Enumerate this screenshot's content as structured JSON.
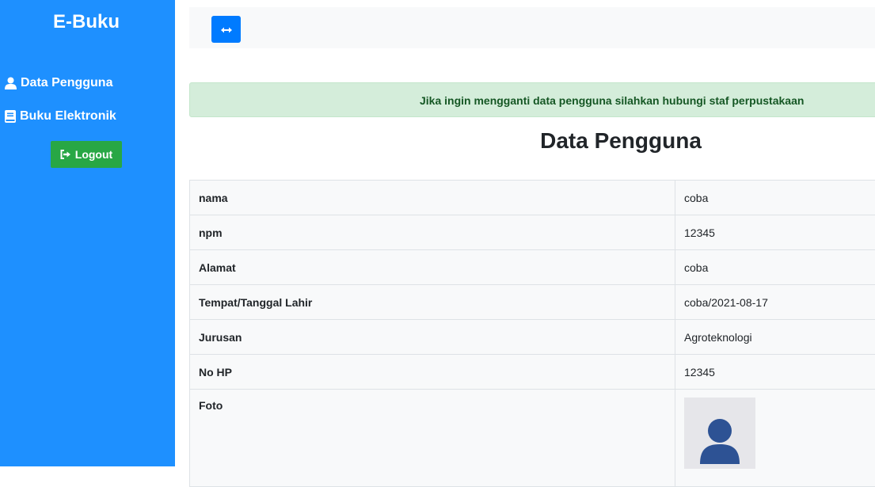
{
  "sidebar": {
    "brand": "E-Buku",
    "items": [
      {
        "label": "Data Pengguna",
        "icon": "user-icon"
      },
      {
        "label": "Buku Elektronik",
        "icon": "book-icon"
      }
    ],
    "logout_label": "Logout",
    "logout_icon": "sign-out-icon"
  },
  "header": {
    "toggle_icon": "arrows-horizontal-icon"
  },
  "alert": {
    "message": "Jika ingin mengganti data pengguna silahkan hubungi staf perpustakaan"
  },
  "main": {
    "title": "Data Pengguna",
    "rows": [
      {
        "label": "nama",
        "value": "coba"
      },
      {
        "label": "npm",
        "value": "12345"
      },
      {
        "label": "Alamat",
        "value": "coba"
      },
      {
        "label": "Tempat/Tanggal Lahir",
        "value": "coba/2021-08-17"
      },
      {
        "label": "Jurusan",
        "value": "Agroteknologi"
      },
      {
        "label": "No HP",
        "value": "12345"
      },
      {
        "label": "Foto",
        "value": ""
      }
    ]
  },
  "colors": {
    "sidebar": "#1e90ff",
    "logout": "#28a745",
    "toggle": "#007bff",
    "alert_bg": "#d4edda",
    "alert_text": "#155724"
  }
}
